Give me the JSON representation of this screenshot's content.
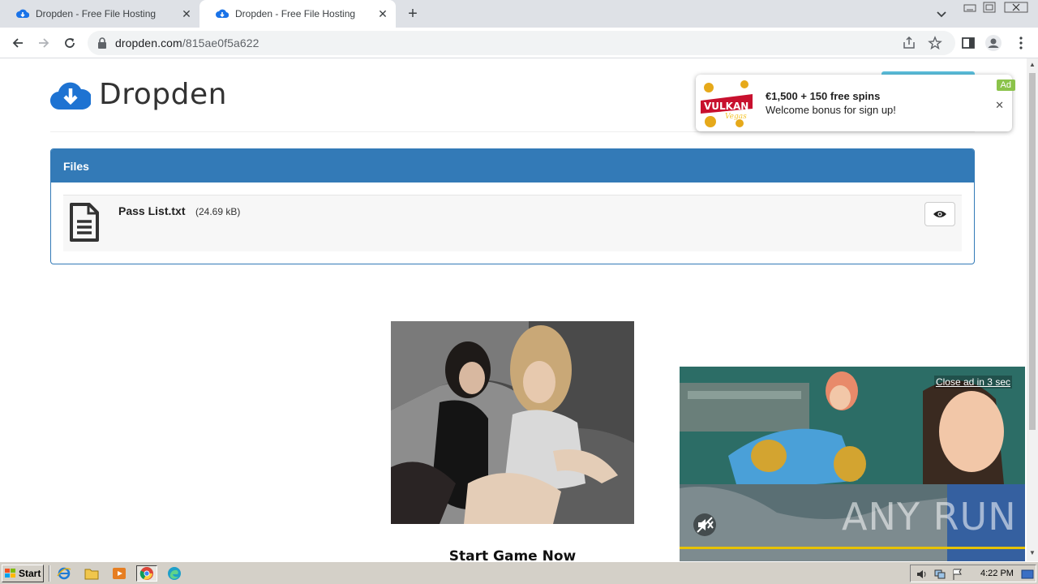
{
  "browser": {
    "tabs": [
      {
        "title": "Dropden - Free File Hosting",
        "active": false
      },
      {
        "title": "Dropden - Free File Hosting",
        "active": true
      }
    ],
    "url_host": "dropden.com",
    "url_path": "/815ae0f5a622"
  },
  "site": {
    "logo_text": "Dropden",
    "brand_color": "#337ab7"
  },
  "files_panel": {
    "heading": "Files",
    "files": [
      {
        "name": "Pass List.txt",
        "size": "(24.69 kB)"
      }
    ]
  },
  "notification_ad": {
    "title": "€1,500 + 150 free spins",
    "body": "Welcome bonus for sign up!",
    "tag": "Ad",
    "close_glyph": "✕"
  },
  "center_ad": {
    "cta": "Start Game Now"
  },
  "video_ad": {
    "close_text": "Close ad in 3 sec",
    "watermark": "ANY RUN"
  },
  "taskbar": {
    "start_label": "Start",
    "clock": "4:22 PM"
  }
}
